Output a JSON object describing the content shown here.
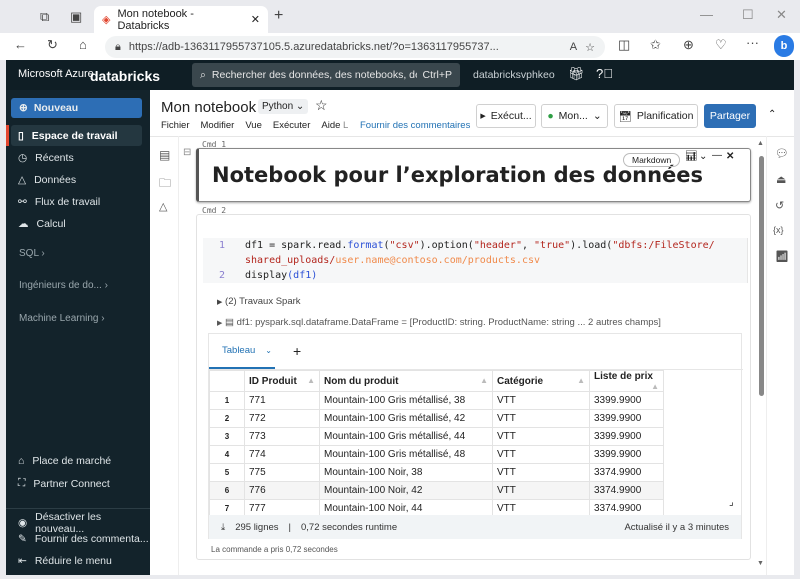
{
  "browser": {
    "tab_title": "Mon notebook - Databricks",
    "url": "https://adb-1363117955737105.5.azuredatabricks.net/?o=1363117955737..."
  },
  "topbar": {
    "brand": "Microsoft Azure",
    "logo": "databricks",
    "search_placeholder": "Rechercher des données, des notebooks, des...",
    "shortcut": "Ctrl+P",
    "workspace": "databricksvphkeo"
  },
  "sidebar": {
    "new_label": "Nouveau",
    "items": [
      {
        "label": "Espace de travail",
        "icon": "workspace-icon",
        "active": true
      },
      {
        "label": "Récents",
        "icon": "clock-icon"
      },
      {
        "label": "Données",
        "icon": "shapes-icon"
      },
      {
        "label": "Flux de travail",
        "icon": "workflow-icon"
      },
      {
        "label": "Calcul",
        "icon": "cloud-icon"
      }
    ],
    "sections": [
      "SQL",
      "Ingénieurs de do...",
      "Machine Learning"
    ],
    "bottom": [
      {
        "label": "Place de marché",
        "icon": "store-icon"
      },
      {
        "label": "Partner Connect",
        "icon": "partner-icon"
      }
    ],
    "footer": [
      {
        "label": "Désactiver les nouveau...",
        "icon": "toggle-icon"
      },
      {
        "label": "Fournir des commenta...",
        "icon": "pencil-icon"
      },
      {
        "label": "Réduire le menu",
        "icon": "collapse-icon"
      }
    ]
  },
  "notebook": {
    "title": "Mon notebook",
    "language": "Python",
    "menu": [
      "Fichier",
      "Modifier",
      "Vue",
      "Exécuter",
      "Aide"
    ],
    "feedback": "Fournir des commentaires",
    "run_label": "Exécut...",
    "cluster_label": "Mon...",
    "schedule_label": "Planification",
    "share_label": "Partager",
    "accent": "#2272b4"
  },
  "cells": [
    {
      "label": "Cmd 1",
      "type_badge": "Markdown",
      "heading": "Notebook pour l’exploration des données"
    },
    {
      "label": "Cmd 2",
      "code_lines": [
        {
          "n": "1",
          "parts": [
            [
              "df1 = spark.read.",
              "#222"
            ],
            [
              "format",
              "#2a4fd6"
            ],
            [
              "(",
              "#222"
            ],
            [
              "\"csv\"",
              "#b3261e"
            ],
            [
              ").option(",
              "#222"
            ],
            [
              "\"header\"",
              "#b3261e"
            ],
            [
              ", ",
              "#222"
            ],
            [
              "\"true\"",
              "#b3261e"
            ],
            [
              ").load(",
              "#222"
            ],
            [
              "\"dbfs:/FileStore/",
              "#b3261e"
            ]
          ]
        },
        {
          "n": "",
          "parts": [
            [
              "shared_uploads/",
              "#b3261e"
            ],
            [
              "user.name@contoso.com/products.csv",
              "#f08a4b"
            ]
          ]
        },
        {
          "n": "2",
          "parts": [
            [
              "display",
              "#222"
            ],
            [
              "(df1)",
              "#2a4fd6"
            ]
          ]
        }
      ],
      "spark_jobs": "(2) Travaux Spark",
      "df_schema": "df1: pyspark.sql.dataframe.DataFrame = [ProductID: string. ProductName: string ... 2 autres champs]",
      "result_tab": "Tableau",
      "columns": [
        "ID Produit",
        "Nom du produit",
        "Catégorie",
        "Liste de prix"
      ],
      "rows": [
        [
          "1",
          "771",
          "Mountain-100 Gris métallisé, 38",
          "VTT",
          "3399.9900"
        ],
        [
          "2",
          "772",
          "Mountain-100 Gris métallisé, 42",
          "VTT",
          "3399.9900"
        ],
        [
          "3",
          "773",
          "Mountain-100 Gris métallisé, 44",
          "VTT",
          "3399.9900"
        ],
        [
          "4",
          "774",
          "Mountain-100 Gris métallisé, 48",
          "VTT",
          "3399.9900"
        ],
        [
          "5",
          "775",
          "Mountain-100 Noir, 38",
          "VTT",
          "3374.9900"
        ],
        [
          "6",
          "776",
          "Mountain-100 Noir, 42",
          "VTT",
          "3374.9900"
        ],
        [
          "7",
          "777",
          "Mountain-100 Noir, 44",
          "VTT",
          "3374.9900"
        ]
      ],
      "row_count": "295 lignes",
      "runtime": "0,72 secondes runtime",
      "refreshed": "Actualisé il y a 3 minutes",
      "footer_note": "La commande a pris 0,72 secondes"
    }
  ]
}
